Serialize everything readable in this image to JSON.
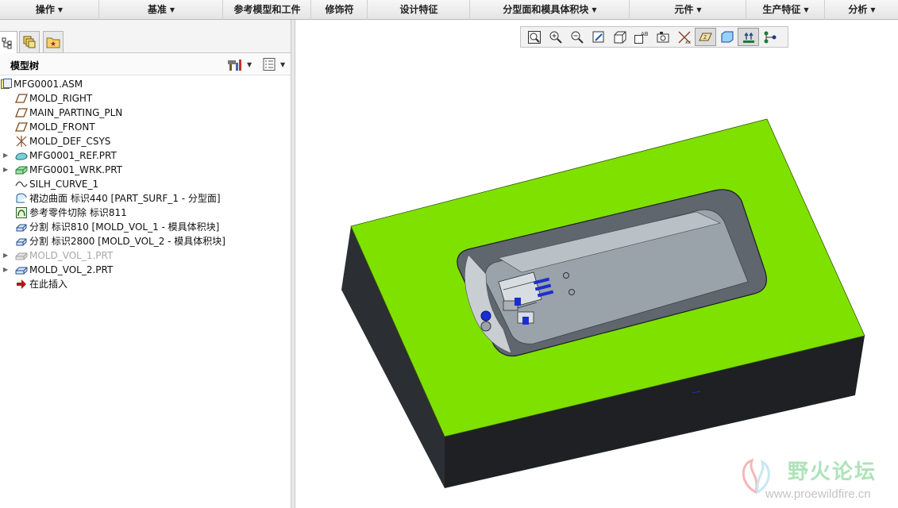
{
  "menubar": {
    "items": [
      {
        "label": "操作",
        "has_dropdown": true
      },
      {
        "label": "基准",
        "has_dropdown": true
      },
      {
        "label": "参考模型和工件",
        "has_dropdown": false
      },
      {
        "label": "修饰符",
        "has_dropdown": false
      },
      {
        "label": "设计特征",
        "has_dropdown": false
      },
      {
        "label": "分型面和模具体积块",
        "has_dropdown": true
      },
      {
        "label": "元件",
        "has_dropdown": true
      },
      {
        "label": "生产特征",
        "has_dropdown": true
      },
      {
        "label": "分析",
        "has_dropdown": true
      }
    ]
  },
  "left_panel": {
    "tabs": [
      "model-tree-tab",
      "layer-tree-tab",
      "favorites-tab"
    ],
    "tree_title": "模型树",
    "tree": [
      {
        "label": "MFG0001.ASM",
        "icon": "assembly-icon",
        "level": 0,
        "expandable": false,
        "disabled": false
      },
      {
        "label": "MOLD_RIGHT",
        "icon": "datum-plane-icon",
        "level": 1,
        "expandable": false,
        "disabled": false
      },
      {
        "label": "MAIN_PARTING_PLN",
        "icon": "datum-plane-icon",
        "level": 1,
        "expandable": false,
        "disabled": false
      },
      {
        "label": "MOLD_FRONT",
        "icon": "datum-plane-icon",
        "level": 1,
        "expandable": false,
        "disabled": false
      },
      {
        "label": "MOLD_DEF_CSYS",
        "icon": "csys-icon",
        "level": 1,
        "expandable": false,
        "disabled": false
      },
      {
        "label": "MFG0001_REF.PRT",
        "icon": "ref-part-icon",
        "level": 1,
        "expandable": true,
        "disabled": false
      },
      {
        "label": "MFG0001_WRK.PRT",
        "icon": "workpiece-icon",
        "level": 1,
        "expandable": true,
        "disabled": false
      },
      {
        "label": "SILH_CURVE_1",
        "icon": "curve-icon",
        "level": 1,
        "expandable": false,
        "disabled": false
      },
      {
        "label": "裙边曲面 标识440 [PART_SURF_1 - 分型面]",
        "icon": "skirt-surface-icon",
        "level": 1,
        "expandable": false,
        "disabled": false
      },
      {
        "label": "参考零件切除 标识811",
        "icon": "ref-part-cutout-icon",
        "level": 1,
        "expandable": false,
        "disabled": false
      },
      {
        "label": "分割 标识810 [MOLD_VOL_1 - 模具体积块]",
        "icon": "split-icon",
        "level": 1,
        "expandable": false,
        "disabled": false
      },
      {
        "label": "分割 标识2800 [MOLD_VOL_2 - 模具体积块]",
        "icon": "split-icon",
        "level": 1,
        "expandable": false,
        "disabled": false
      },
      {
        "label": "MOLD_VOL_1.PRT",
        "icon": "mold-volume-part-icon",
        "level": 1,
        "expandable": true,
        "disabled": true
      },
      {
        "label": "MOLD_VOL_2.PRT",
        "icon": "mold-volume-part-icon",
        "level": 1,
        "expandable": true,
        "disabled": false
      },
      {
        "label": "在此插入",
        "icon": "insert-here-arrow-icon",
        "level": 1,
        "expandable": false,
        "disabled": false
      }
    ]
  },
  "view_toolbar": {
    "buttons": [
      {
        "icon": "refit-icon",
        "pressed": false
      },
      {
        "icon": "zoom-in-icon",
        "pressed": false
      },
      {
        "icon": "zoom-out-icon",
        "pressed": false
      },
      {
        "icon": "repaint-icon",
        "pressed": false
      },
      {
        "icon": "display-style-icon",
        "pressed": false
      },
      {
        "icon": "saved-views-icon",
        "pressed": false
      },
      {
        "icon": "perspective-icon",
        "pressed": false
      },
      {
        "icon": "datum-csys-display-icon",
        "pressed": false
      },
      {
        "icon": "datum-plane-display-icon",
        "pressed": true
      },
      {
        "icon": "annotation-display-icon",
        "pressed": false
      },
      {
        "icon": "spin-center-icon",
        "pressed": true
      },
      {
        "icon": "model-tree-display-icon",
        "pressed": false
      }
    ]
  },
  "colors": {
    "mold_top": "#7ee100",
    "mold_side_dark": "#2a2d30",
    "mold_side_darker": "#1b1d20",
    "cavity_floor": "#9aa2aa",
    "feature_blue": "#1a2fd0"
  },
  "watermark": {
    "text": "野火论坛",
    "url": "www.proewildfire.cn"
  }
}
